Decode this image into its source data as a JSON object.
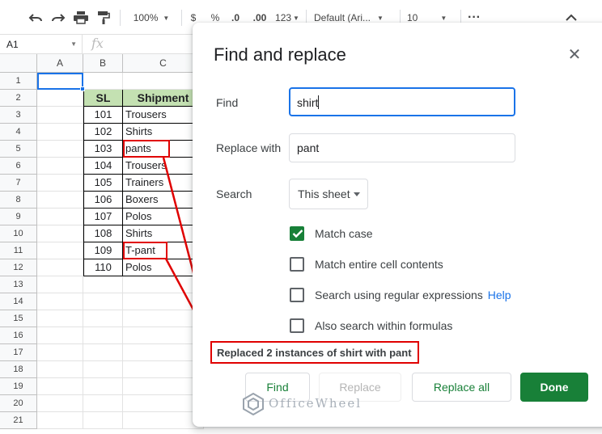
{
  "toolbar": {
    "zoom": "100%",
    "currency": "$",
    "percent": "%",
    "decrease_decimals": ".0",
    "increase_decimals": ".00",
    "more_formats": "123",
    "font": "Default (Ari...",
    "font_size": "10"
  },
  "formula_bar": {
    "cell_ref": "A1",
    "fx": "fx"
  },
  "columns": [
    "A",
    "B",
    "C"
  ],
  "rows": [
    "1",
    "2",
    "3",
    "4",
    "5",
    "6",
    "7",
    "8",
    "9",
    "10",
    "11",
    "12",
    "13",
    "14",
    "15",
    "16",
    "17",
    "18",
    "19",
    "20",
    "21"
  ],
  "table": {
    "headers": [
      "SL",
      "Shipment"
    ],
    "rows": [
      [
        "101",
        "Trousers"
      ],
      [
        "102",
        "Shirts"
      ],
      [
        "103",
        "pants"
      ],
      [
        "104",
        "Trousers"
      ],
      [
        "105",
        "Trainers"
      ],
      [
        "106",
        "Boxers"
      ],
      [
        "107",
        "Polos"
      ],
      [
        "108",
        "Shirts"
      ],
      [
        "109",
        "T-pant"
      ],
      [
        "110",
        "Polos"
      ]
    ]
  },
  "dialog": {
    "title": "Find and replace",
    "find_label": "Find",
    "find_value": "shirt",
    "replace_label": "Replace with",
    "replace_value": "pant",
    "search_label": "Search",
    "search_value": "This sheet",
    "options": [
      {
        "label": "Match case",
        "checked": true
      },
      {
        "label": "Match entire cell contents",
        "checked": false
      },
      {
        "label": "Search using regular expressions",
        "checked": false,
        "help": "Help"
      },
      {
        "label": "Also search within formulas",
        "checked": false
      }
    ],
    "status": "Replaced 2 instances of shirt with pant",
    "buttons": {
      "find": "Find",
      "replace": "Replace",
      "replace_all": "Replace all",
      "done": "Done"
    }
  },
  "watermark": "OfficeWheel",
  "colors": {
    "accent": "#1a73e8",
    "green": "#188038",
    "header_fill": "#c4e1b2",
    "annotation": "#e00000"
  }
}
